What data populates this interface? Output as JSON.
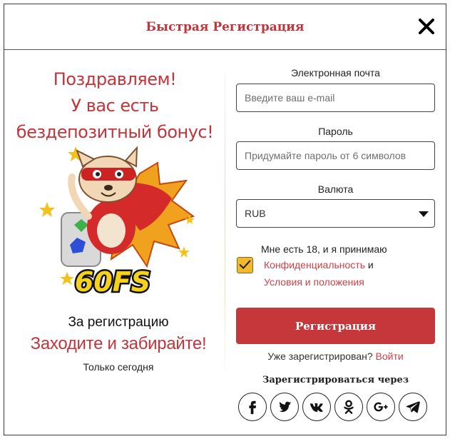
{
  "header": {
    "title": "Быстрая Регистрация",
    "close_icon": "close-icon"
  },
  "promo": {
    "heading": [
      "Поздравляем!",
      "У вас есть",
      "бездепозитный бонус!"
    ],
    "bonus_badge": "60FS",
    "line1": "За регистрацию",
    "line2": "Заходите и забирайте!",
    "line3": "Только сегодня"
  },
  "form": {
    "email": {
      "label": "Электронная почта",
      "placeholder": "Введите ваш e-mail",
      "value": ""
    },
    "password": {
      "label": "Пароль",
      "placeholder": "Придумайте пароль от 6 символов",
      "value": ""
    },
    "currency": {
      "label": "Валюта",
      "selected": "RUB"
    },
    "agreement": {
      "checked": true,
      "text1": "Мне есть 18, и я принимаю",
      "link_privacy": "Конфиденциальность",
      "and": " и",
      "link_terms": "Условия и положения"
    },
    "submit_label": "Регистрация",
    "already_text": "Уже зарегистрирован?",
    "login_link": "Войти",
    "social_title": "Зарегистрироваться через",
    "socials": [
      "facebook-icon",
      "twitter-icon",
      "vk-icon",
      "odnoklassniki-icon",
      "google-plus-icon",
      "telegram-icon"
    ]
  },
  "colors": {
    "accent": "#c6373c",
    "checkbox": "#f4b82d",
    "link": "#d04048"
  }
}
